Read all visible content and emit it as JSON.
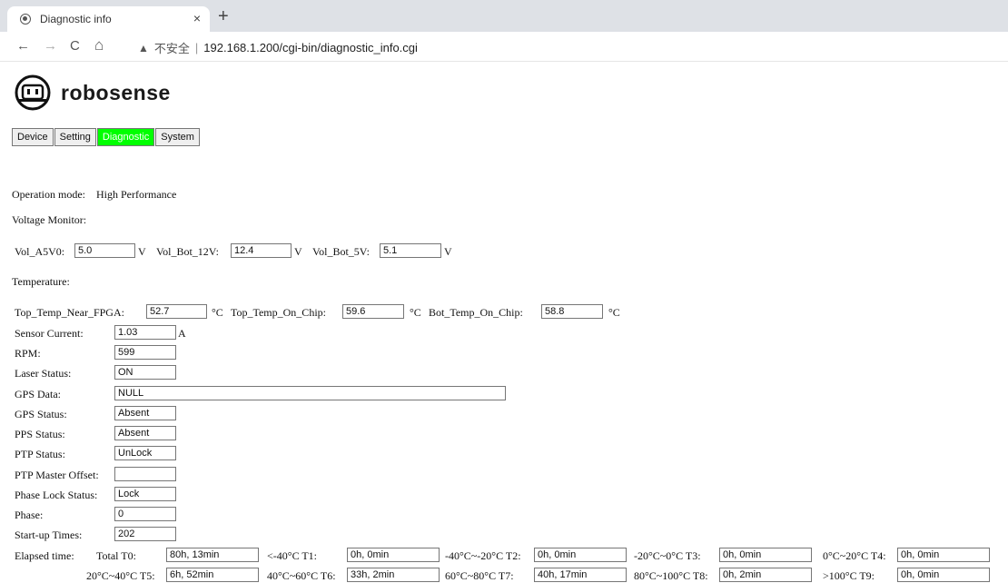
{
  "browser": {
    "tab_title": "Diagnostic info",
    "close_glyph": "×",
    "new_tab_glyph": "+",
    "back_glyph": "←",
    "forward_glyph": "→",
    "reload_glyph": "C",
    "home_glyph": "⌂",
    "warning_glyph": "▲",
    "insecure_label": "不安全",
    "separator": "|",
    "url": "192.168.1.200/cgi-bin/diagnostic_info.cgi"
  },
  "logo": {
    "text": "robosense",
    "icon": "robot-face-icon"
  },
  "nav": {
    "tabs": [
      "Device",
      "Setting",
      "Diagnostic",
      "System"
    ],
    "active": "Diagnostic",
    "active_color": "#00ff00"
  },
  "operation": {
    "label": "Operation mode:",
    "value": "High Performance"
  },
  "voltage": {
    "title": "Voltage Monitor:",
    "a5v0_label": "Vol_A5V0:",
    "a5v0_value": "5.0",
    "bot12_label": "Vol_Bot_12V:",
    "bot12_value": "12.4",
    "bot5_label": "Vol_Bot_5V:",
    "bot5_value": "5.1",
    "unit": "V"
  },
  "temperature": {
    "title": "Temperature:",
    "near_fpga_label": "Top_Temp_Near_FPGA:",
    "near_fpga_value": "52.7",
    "top_chip_label": "Top_Temp_On_Chip:",
    "top_chip_value": "59.6",
    "bot_chip_label": "Bot_Temp_On_Chip:",
    "bot_chip_value": "58.8",
    "unit": "°C"
  },
  "status": {
    "sensor_current": {
      "label": "Sensor Current:",
      "value": "1.03",
      "unit": "A"
    },
    "rpm": {
      "label": "RPM:",
      "value": "599"
    },
    "laser": {
      "label": "Laser Status:",
      "value": "ON"
    },
    "gps_data": {
      "label": "GPS Data:",
      "value": "NULL"
    },
    "gps_status": {
      "label": "GPS Status:",
      "value": "Absent"
    },
    "pps": {
      "label": "PPS Status:",
      "value": "Absent"
    },
    "ptp": {
      "label": "PTP Status:",
      "value": "UnLock"
    },
    "ptp_offset": {
      "label": "PTP Master Offset:",
      "value": ""
    },
    "phase_lock": {
      "label": "Phase Lock Status:",
      "value": "Lock"
    },
    "phase": {
      "label": "Phase:",
      "value": "0"
    },
    "startup": {
      "label": "Start-up Times:",
      "value": "202"
    }
  },
  "elapsed": {
    "title": "Elapsed time:",
    "t0_label": "Total T0:",
    "t0_value": "80h, 13min",
    "t1_label": "<-40°C T1:",
    "t1_value": "0h, 0min",
    "t2_label": "-40°C~-20°C T2:",
    "t2_value": "0h, 0min",
    "t3_label": "-20°C~0°C T3:",
    "t3_value": "0h, 0min",
    "t4_label": "0°C~20°C T4:",
    "t4_value": "0h, 0min",
    "t5_label": "20°C~40°C T5:",
    "t5_value": "6h, 52min",
    "t6_label": "40°C~60°C T6:",
    "t6_value": "33h, 2min",
    "t7_label": "60°C~80°C T7:",
    "t7_value": "40h, 17min",
    "t8_label": "80°C~100°C T8:",
    "t8_value": "0h, 2min",
    "t9_label": ">100°C T9:",
    "t9_value": "0h, 0min"
  }
}
